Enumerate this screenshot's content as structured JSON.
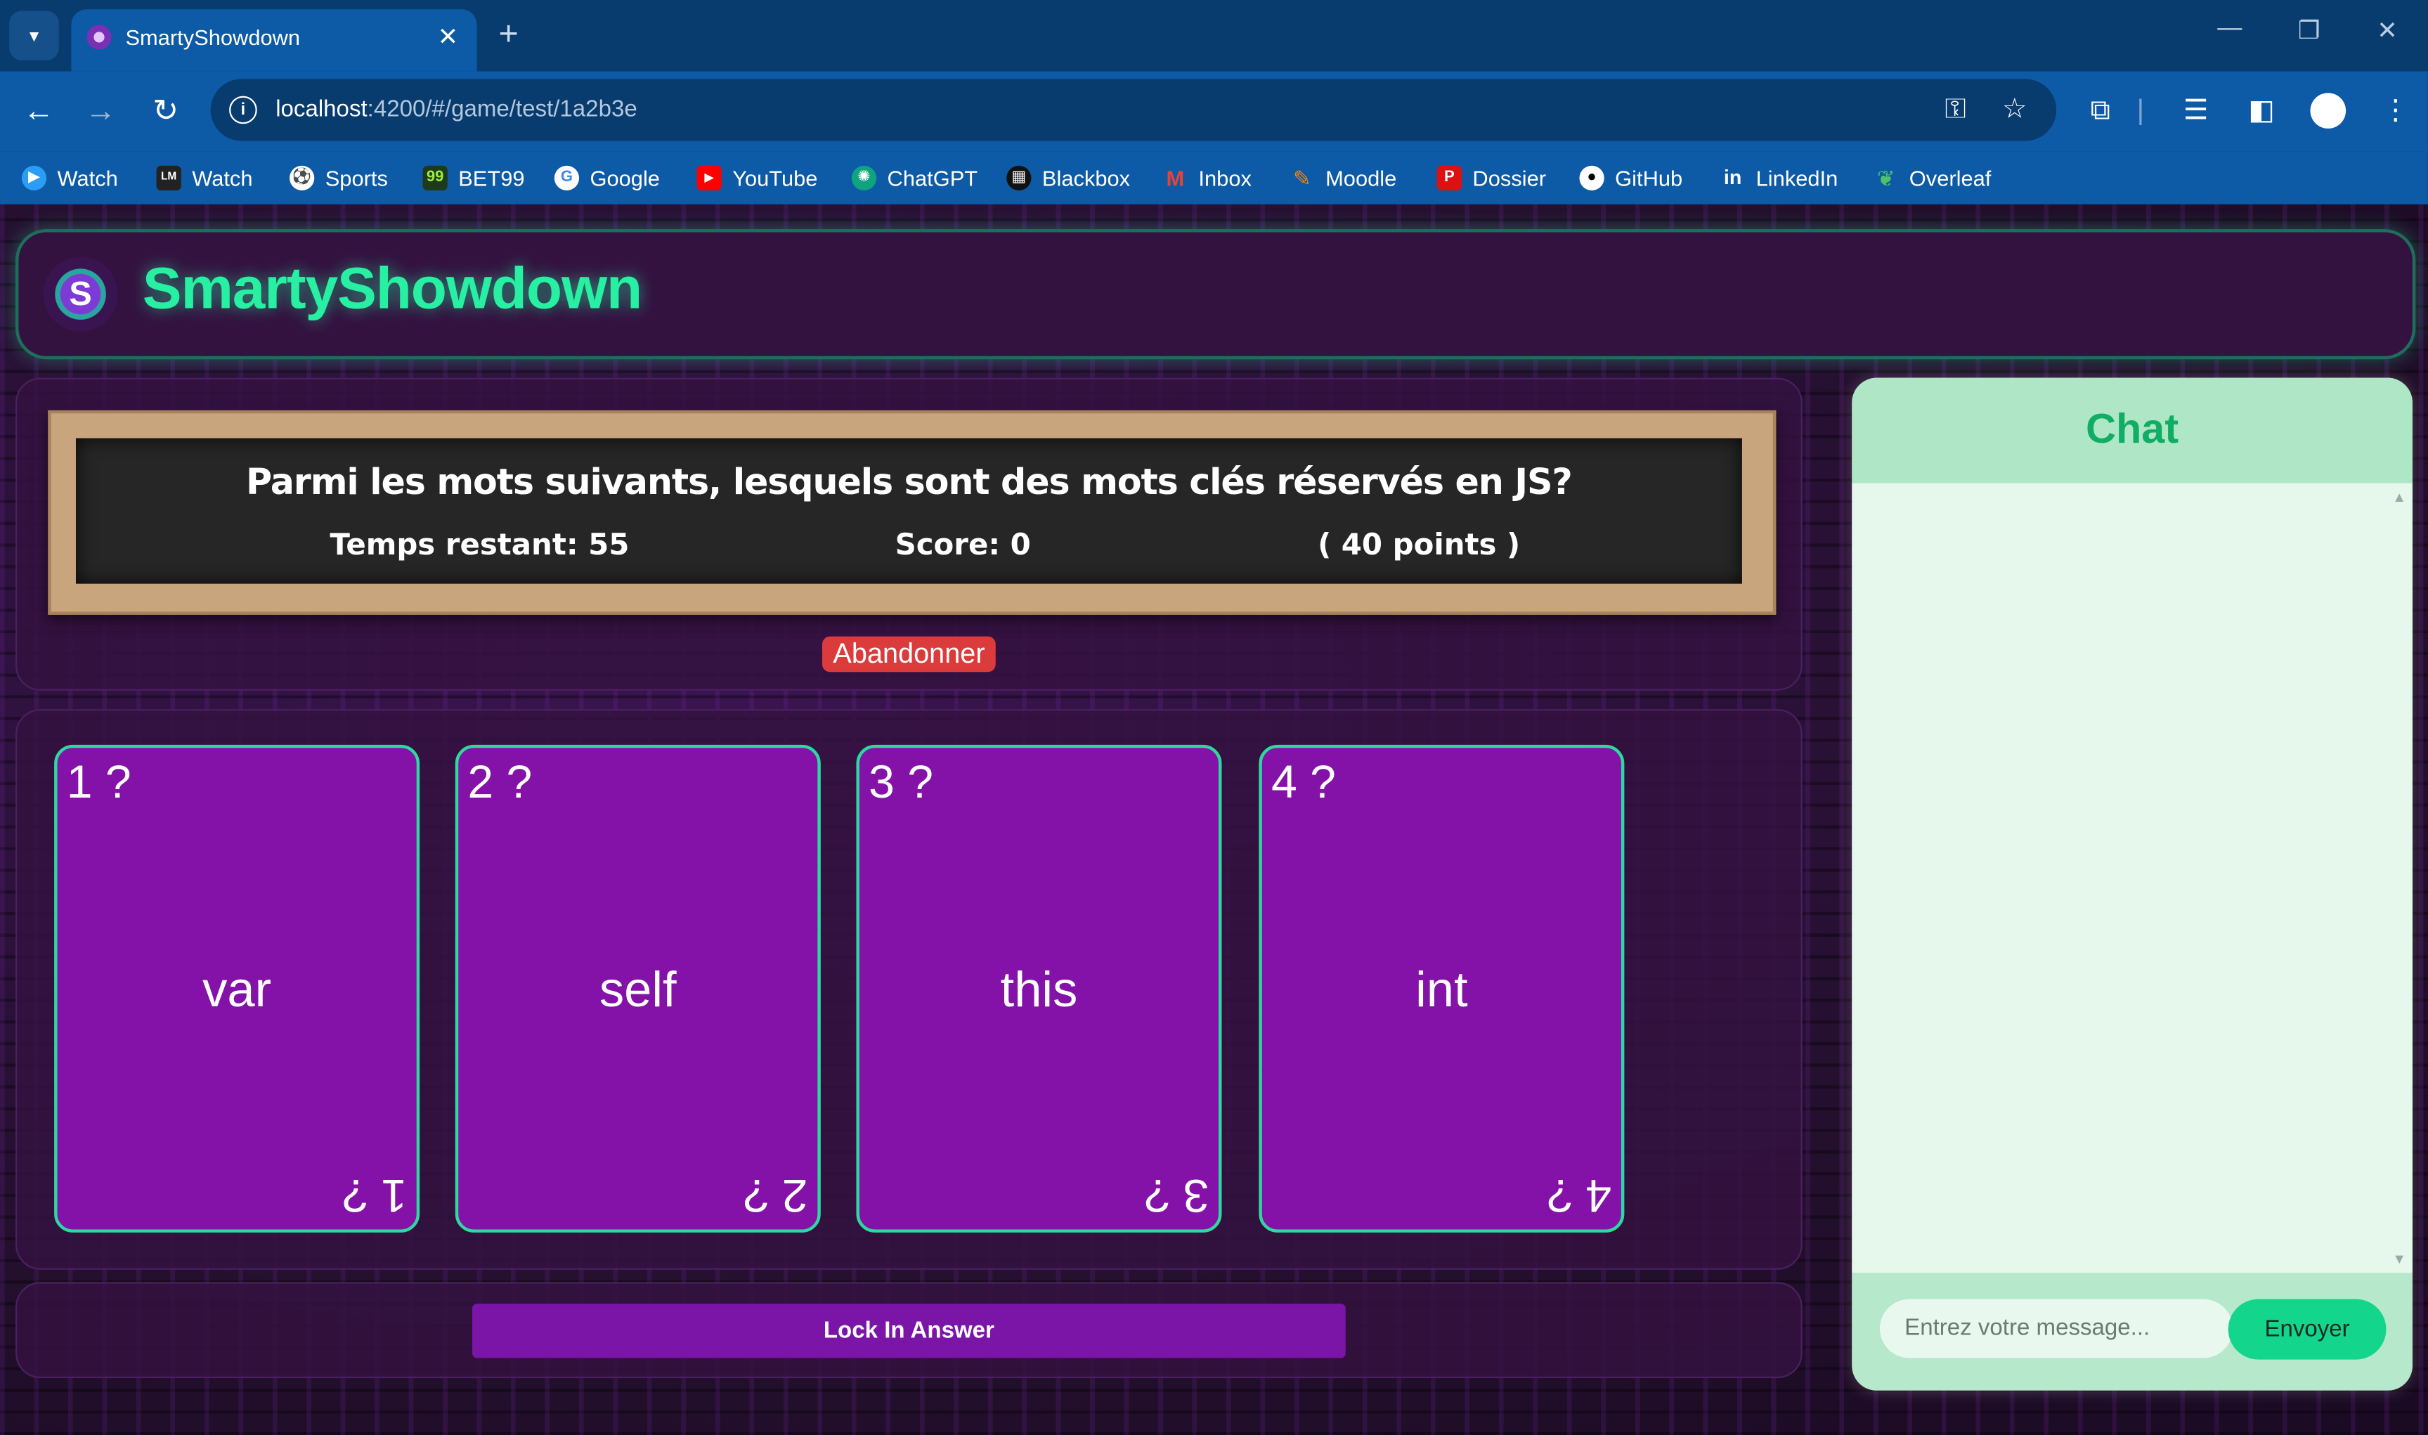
{
  "browser": {
    "tab_title": "SmartyShowdown",
    "tab_close": "✕",
    "new_tab": "+",
    "url_host": "localhost",
    "url_rest": ":4200/#/game/test/1a2b3e",
    "bookmarks": [
      "Watch",
      "Watch",
      "Sports",
      "BET99",
      "Google",
      "YouTube",
      "ChatGPT",
      "Blackbox",
      "Inbox",
      "Moodle",
      "Dossier",
      "GitHub",
      "LinkedIn",
      "Overleaf"
    ]
  },
  "app": {
    "title": "SmartyShowdown",
    "logo_letter": "S"
  },
  "question": {
    "text": "Parmi les mots suivants, lesquels sont des mots clés réservés en JS?",
    "time_label": "Temps restant: 55",
    "score_label": "Score: 0",
    "points_label": "( 40 points )",
    "abandon_label": "Abandonner"
  },
  "cards": [
    {
      "corner": "1 ?",
      "word": "var"
    },
    {
      "corner": "2 ?",
      "word": "self"
    },
    {
      "corner": "3 ?",
      "word": "this"
    },
    {
      "corner": "4 ?",
      "word": "int"
    }
  ],
  "lock_label": "Lock In Answer",
  "chat": {
    "title": "Chat",
    "placeholder": "Entrez votre message...",
    "send_label": "Envoyer"
  },
  "colors": {
    "accent_green": "#27f0a2",
    "card_purple": "#8412a8",
    "danger": "#dc3b3b"
  }
}
